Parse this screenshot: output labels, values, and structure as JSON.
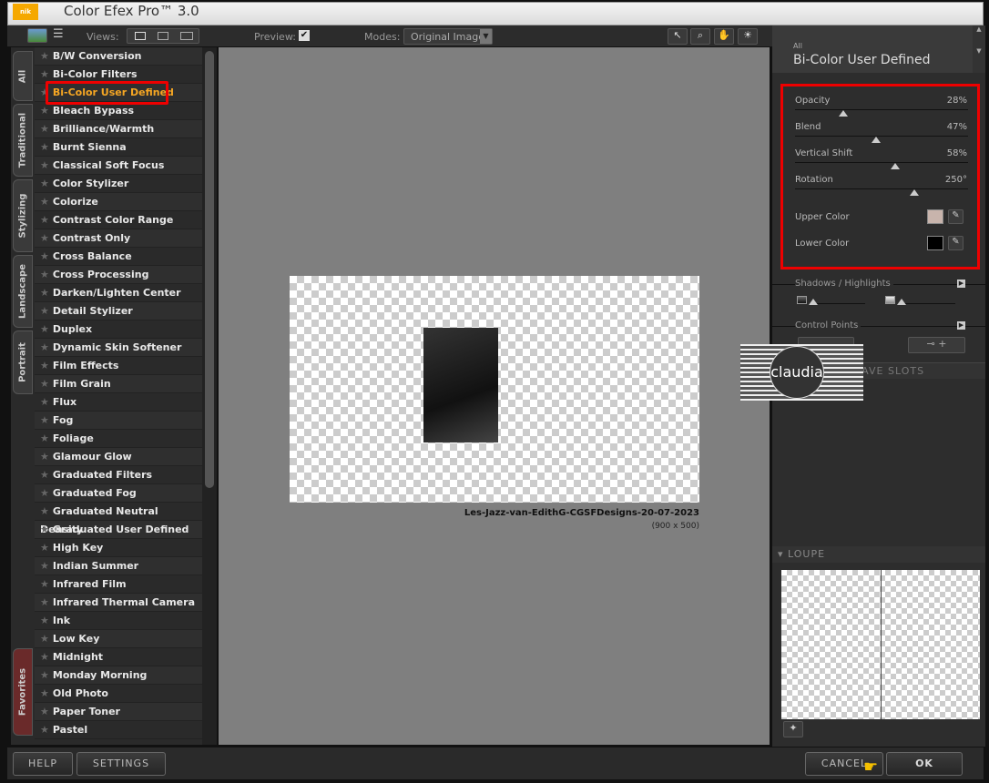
{
  "app": {
    "title": "Color Efex Pro™ 3.0",
    "logo": "nik Software"
  },
  "toolbar": {
    "views_label": "Views:",
    "preview_label": "Preview:",
    "preview_checked": true,
    "modes_label": "Modes:",
    "modes_value": "Original Image"
  },
  "tabs": [
    "All",
    "Traditional",
    "Stylizing",
    "Landscape",
    "Portrait",
    "Favorites"
  ],
  "filters": [
    "B/W Conversion",
    "Bi-Color Filters",
    "Bi-Color User Defined",
    "Bleach Bypass",
    "Brilliance/Warmth",
    "Burnt Sienna",
    "Classical Soft Focus",
    "Color Stylizer",
    "Colorize",
    "Contrast Color Range",
    "Contrast Only",
    "Cross Balance",
    "Cross Processing",
    "Darken/Lighten Center",
    "Detail Stylizer",
    "Duplex",
    "Dynamic Skin Softener",
    "Film Effects",
    "Film Grain",
    "Flux",
    "Fog",
    "Foliage",
    "Glamour Glow",
    "Graduated Filters",
    "Graduated Fog",
    "Graduated Neutral Density",
    "Graduated User Defined",
    "High Key",
    "Indian Summer",
    "Infrared Film",
    "Infrared Thermal Camera",
    "Ink",
    "Low Key",
    "Midnight",
    "Monday Morning",
    "Old Photo",
    "Paper Toner",
    "Pastel"
  ],
  "selected_filter": "Bi-Color User Defined",
  "preview": {
    "filename": "Les-Jazz-van-EdithG-CGSFDesigns-20-07-2023",
    "dimensions": "(900 x 500)"
  },
  "panel": {
    "category": "All",
    "filter_name": "Bi-Color User Defined",
    "sliders": [
      {
        "label": "Opacity",
        "value": "28%",
        "level": 28
      },
      {
        "label": "Blend",
        "value": "47%",
        "level": 47
      },
      {
        "label": "Vertical Shift",
        "value": "58%",
        "level": 58
      },
      {
        "label": "Rotation",
        "value": "250°",
        "level": 69
      }
    ],
    "upper_color_label": "Upper Color",
    "upper_color": "#c8b4ac",
    "lower_color_label": "Lower Color",
    "lower_color": "#000000",
    "shadows_label": "Shadows / Highlights",
    "control_points_label": "Control Points",
    "save_slots_label": "SAVE SLOTS",
    "loupe_label": "LOUPE"
  },
  "watermark": "claudia",
  "buttons": {
    "help": "HELP",
    "settings": "SETTINGS",
    "cancel": "CANCEL",
    "ok": "OK"
  },
  "colors": {
    "accent": "#f5a623",
    "highlight": "#e00000"
  }
}
